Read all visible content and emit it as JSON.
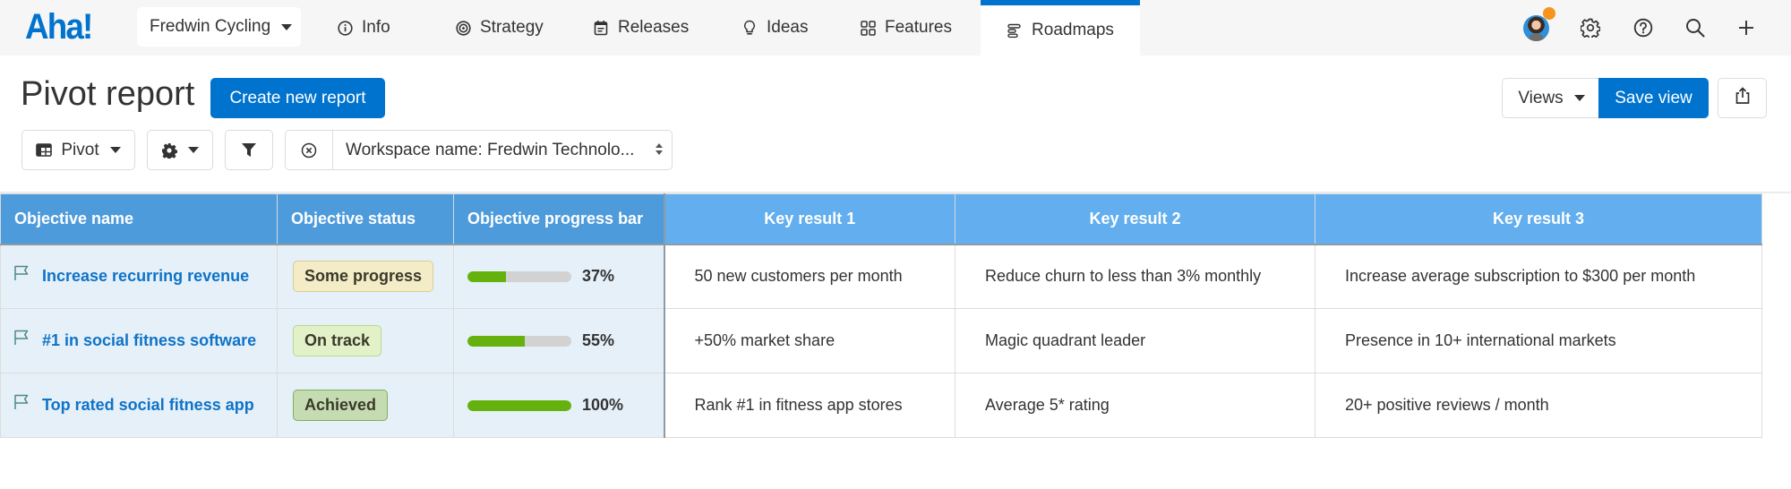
{
  "nav": {
    "logo": "Aha!",
    "project": "Fredwin Cycling",
    "tabs": [
      {
        "label": "Info",
        "icon": "info-icon"
      },
      {
        "label": "Strategy",
        "icon": "target-icon"
      },
      {
        "label": "Releases",
        "icon": "calendar-icon"
      },
      {
        "label": "Ideas",
        "icon": "lightbulb-icon"
      },
      {
        "label": "Features",
        "icon": "grid-icon"
      },
      {
        "label": "Roadmaps",
        "icon": "roadmap-icon",
        "active": true
      }
    ],
    "right_icons": [
      "avatar",
      "gear-icon",
      "help-icon",
      "search-icon",
      "plus-icon"
    ],
    "notification_color": "#f7941d"
  },
  "header": {
    "title": "Pivot report",
    "create_button": "Create new report",
    "views_button": "Views",
    "save_view_button": "Save view"
  },
  "toolbar": {
    "pivot_button": "Pivot",
    "filter_value": "Workspace name: Fredwin Technolo..."
  },
  "colors": {
    "accent": "#0073cf",
    "row_header_bg": "#4e9bdb",
    "col_header_bg": "#62aeee",
    "row_cell_bg": "#e6f0f9",
    "progress_fill": "#65b20e"
  },
  "table": {
    "row_headers": [
      "Objective name",
      "Objective status",
      "Objective progress bar"
    ],
    "col_headers": [
      "Key result 1",
      "Key result 2",
      "Key result 3"
    ],
    "rows": [
      {
        "name": "Increase recurring revenue",
        "status": "Some progress",
        "status_bg": "#f3ecc7",
        "status_border": "#d9cf8e",
        "progress": 37,
        "progress_label": "37%",
        "key_results": [
          "50 new customers per month",
          "Reduce churn to less than 3% monthly",
          "Increase average subscription to $300 per month"
        ]
      },
      {
        "name": "#1 in social fitness software",
        "status": "On track",
        "status_bg": "#e3f1c8",
        "status_border": "#b6d98a",
        "progress": 55,
        "progress_label": "55%",
        "key_results": [
          "+50% market share",
          "Magic quadrant leader",
          "Presence in 10+ international markets"
        ]
      },
      {
        "name": "Top rated social fitness app",
        "status": "Achieved",
        "status_bg": "#c5dcb2",
        "status_border": "#7fae5b",
        "progress": 100,
        "progress_label": "100%",
        "key_results": [
          "Rank #1 in fitness app stores",
          "Average 5* rating",
          "20+ positive reviews / month"
        ]
      }
    ]
  }
}
